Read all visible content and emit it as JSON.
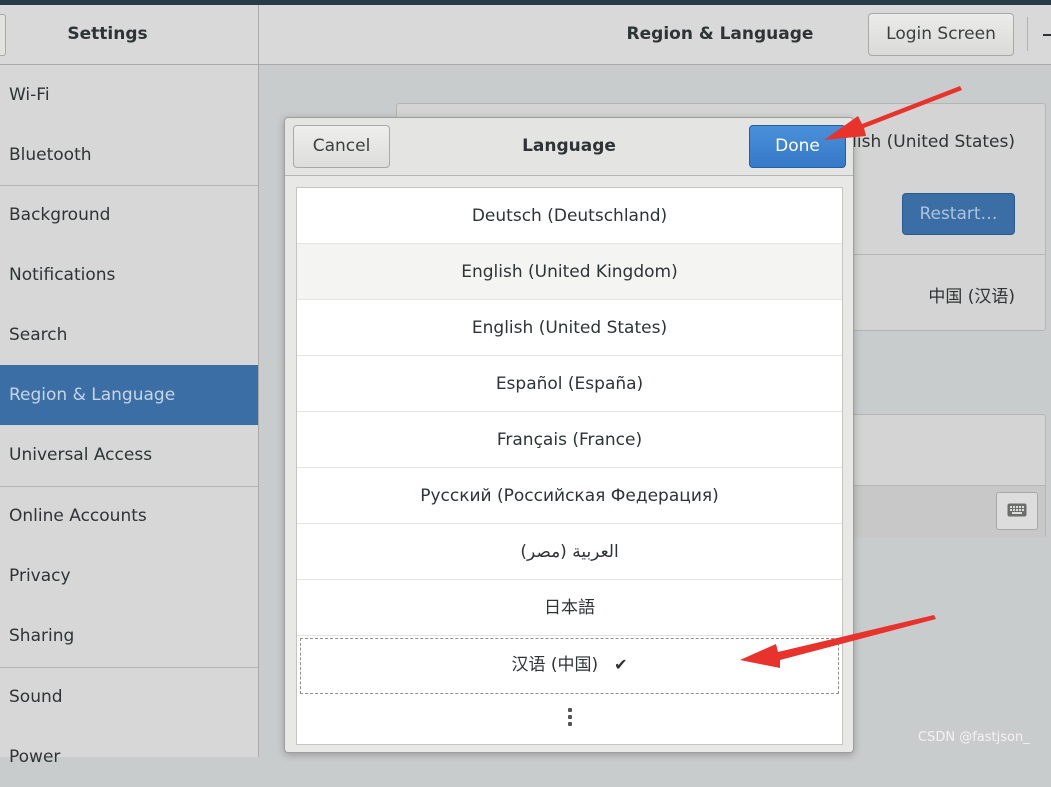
{
  "header": {
    "settings_title": "Settings",
    "page_title": "Region & Language",
    "login_screen_label": "Login Screen"
  },
  "sidebar": {
    "items": [
      {
        "label": "Wi-Fi"
      },
      {
        "label": "Bluetooth"
      },
      {
        "label": "Background"
      },
      {
        "label": "Notifications"
      },
      {
        "label": "Search"
      },
      {
        "label": "Region & Language",
        "active": true
      },
      {
        "label": "Universal Access"
      },
      {
        "label": "Online Accounts"
      },
      {
        "label": "Privacy"
      },
      {
        "label": "Sharing"
      },
      {
        "label": "Sound"
      },
      {
        "label": "Power"
      }
    ]
  },
  "main": {
    "language_value": "English (United States)",
    "restart_label": "Restart…",
    "formats_value": "中国 (汉语)"
  },
  "dialog": {
    "title": "Language",
    "cancel_label": "Cancel",
    "done_label": "Done",
    "languages": [
      "Deutsch (Deutschland)",
      "English (United Kingdom)",
      "English (United States)",
      "Español (España)",
      "Français (France)",
      "Русский (Российская Федерация)",
      "العربية (مصر)",
      "日本語",
      "汉语 (中国)"
    ],
    "selected_language": "汉语 (中国)",
    "checkmark": "✔"
  },
  "watermark": "CSDN @fastjson_",
  "colors": {
    "accent": "#3a6ea5",
    "done_button": "#4a90d9",
    "annotation_arrow": "#e8322c"
  },
  "icons": {
    "keyboard": "keyboard-icon",
    "more": "view-more-icon"
  }
}
